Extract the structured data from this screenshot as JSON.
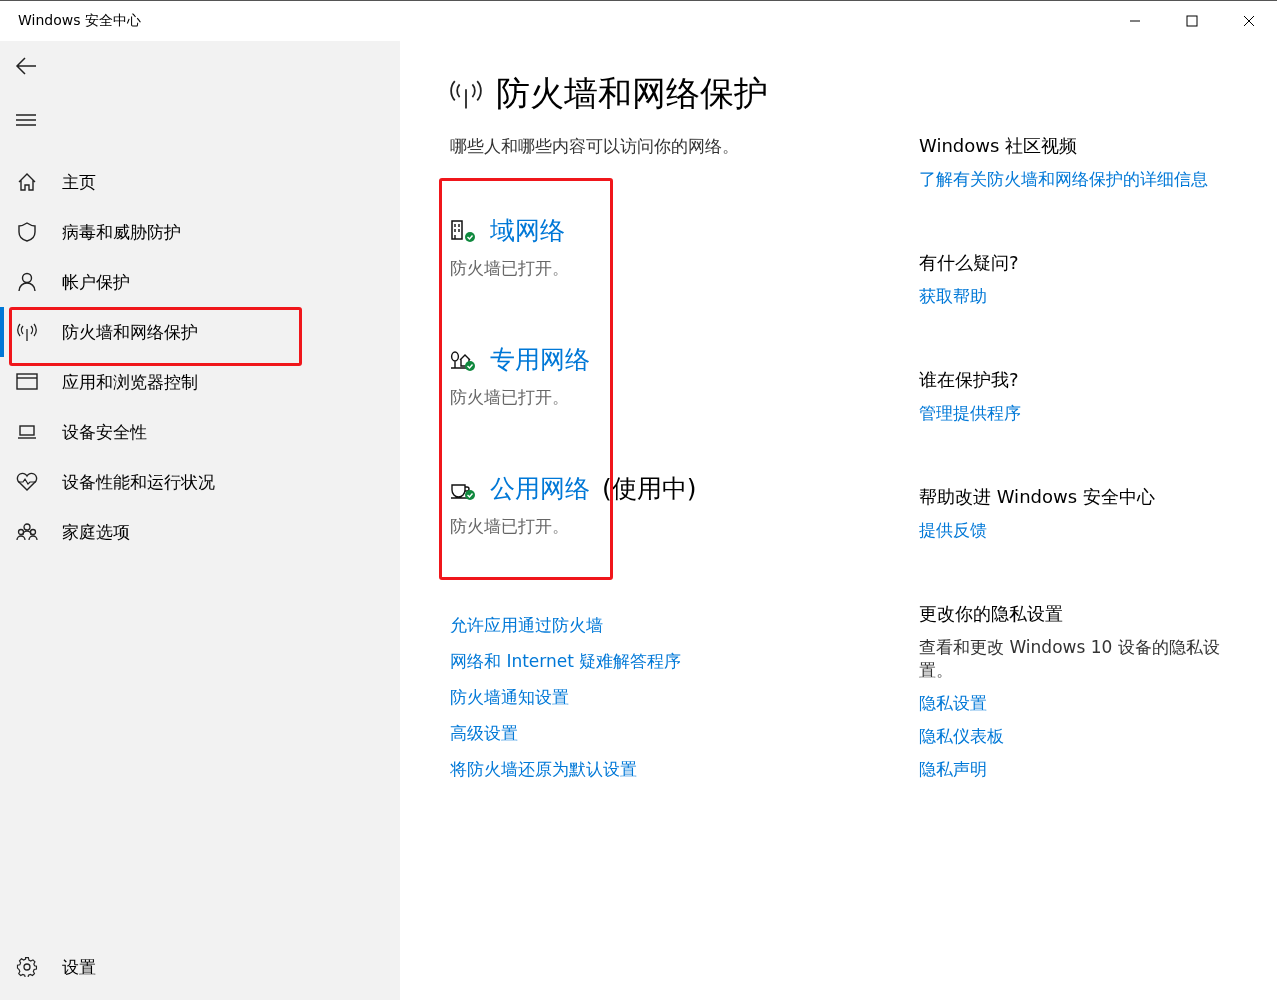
{
  "window": {
    "title": "Windows 安全中心"
  },
  "sidebar": {
    "items": [
      {
        "label": "主页",
        "selected": false
      },
      {
        "label": "病毒和威胁防护",
        "selected": false
      },
      {
        "label": "帐户保护",
        "selected": false
      },
      {
        "label": "防火墙和网络保护",
        "selected": true
      },
      {
        "label": "应用和浏览器控制",
        "selected": false
      },
      {
        "label": "设备安全性",
        "selected": false
      },
      {
        "label": "设备性能和运行状况",
        "selected": false
      },
      {
        "label": "家庭选项",
        "selected": false
      }
    ],
    "settings": "设置"
  },
  "page": {
    "title": "防火墙和网络保护",
    "subtitle": "哪些人和哪些内容可以访问你的网络。",
    "networks": [
      {
        "name": "域网络",
        "status": "防火墙已打开。"
      },
      {
        "name": "专用网络",
        "status": "防火墙已打开。"
      },
      {
        "name": "公用网络",
        "note": "(使用中)",
        "status": "防火墙已打开。"
      }
    ],
    "links": [
      "允许应用通过防火墙",
      "网络和 Internet 疑难解答程序",
      "防火墙通知设置",
      "高级设置",
      "将防火墙还原为默认设置"
    ]
  },
  "side_panel": [
    {
      "heading": "Windows 社区视频",
      "links": [
        "了解有关防火墙和网络保护的详细信息"
      ]
    },
    {
      "heading": "有什么疑问?",
      "links": [
        "获取帮助"
      ]
    },
    {
      "heading": "谁在保护我?",
      "links": [
        "管理提供程序"
      ]
    },
    {
      "heading": "帮助改进 Windows 安全中心",
      "links": [
        "提供反馈"
      ]
    },
    {
      "heading": "更改你的隐私设置",
      "text": "查看和更改 Windows 10 设备的隐私设置。",
      "links": [
        "隐私设置",
        "隐私仪表板",
        "隐私声明"
      ]
    }
  ]
}
